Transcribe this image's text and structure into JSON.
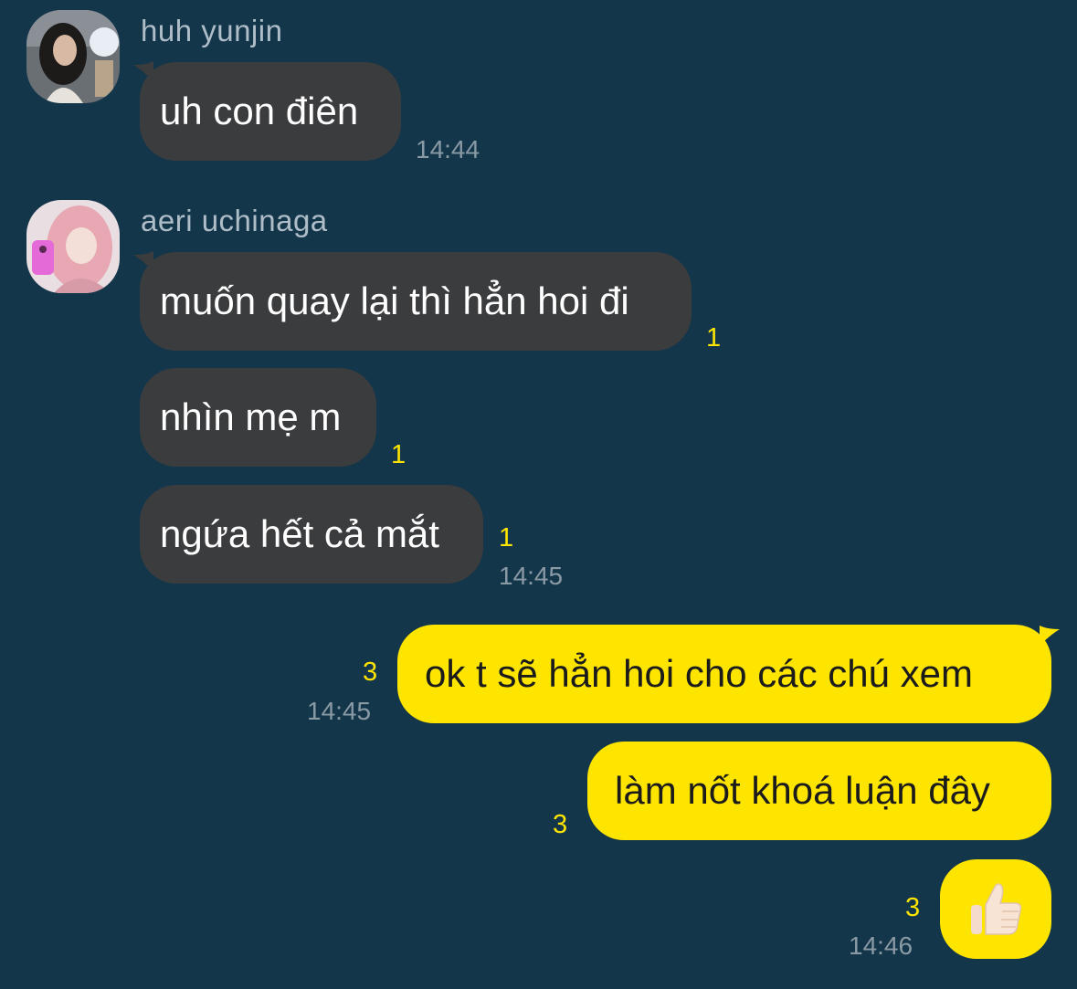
{
  "chat": {
    "messages": [
      {
        "sender": "huh yunjin",
        "avatar": "avatar-huh-yunjin",
        "text": "uh con điên",
        "time": "14:44"
      },
      {
        "sender": "aeri uchinaga",
        "avatar": "avatar-aeri-uchinaga",
        "text": "muốn quay lại thì hẳn hoi đi",
        "unread": "1"
      },
      {
        "text": "nhìn mẹ m",
        "unread": "1"
      },
      {
        "text": "ngứa hết cả mắt",
        "unread": "1",
        "time": "14:45"
      },
      {
        "text": "ok t sẽ hẳn hoi cho các chú xem",
        "unread": "3",
        "time": "14:45"
      },
      {
        "text": "làm nốt khoá luận đây",
        "unread": "3"
      },
      {
        "icon": "thumbs-up-emoji-icon",
        "unread": "3",
        "time": "14:46"
      }
    ]
  },
  "colors": {
    "background": "#13364a",
    "incoming_bubble": "#3b3c3e",
    "outgoing_bubble": "#fee500",
    "unread_count": "#fee500",
    "timestamp": "#8a9aa5"
  }
}
